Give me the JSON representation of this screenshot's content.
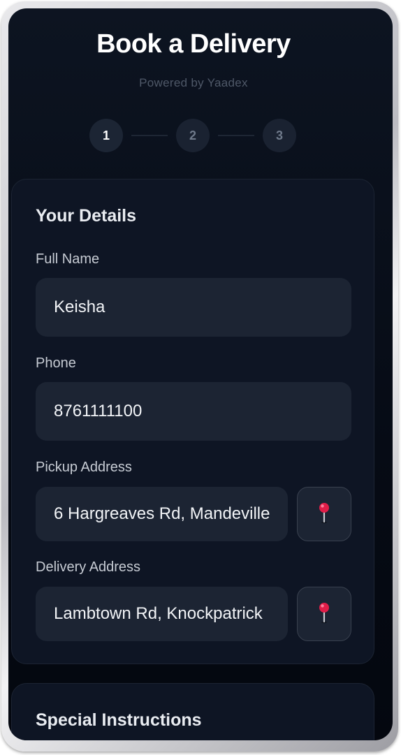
{
  "header": {
    "title": "Book a Delivery",
    "subtitle": "Powered by Yaadex"
  },
  "stepper": {
    "steps": [
      {
        "label": "1",
        "active": true
      },
      {
        "label": "2",
        "active": false
      },
      {
        "label": "3",
        "active": false
      }
    ]
  },
  "details": {
    "title": "Your Details",
    "full_name": {
      "label": "Full Name",
      "value": "Keisha"
    },
    "phone": {
      "label": "Phone",
      "value": "8761111100"
    },
    "pickup": {
      "label": "Pickup Address",
      "value": "6 Hargreaves Rd, Mandeville",
      "icon": "map-pin-icon"
    },
    "delivery": {
      "label": "Delivery Address",
      "value": "Lambtown Rd, Knockpatrick",
      "icon": "map-pin-icon"
    }
  },
  "special": {
    "title": "Special Instructions"
  },
  "colors": {
    "background": "#060b15",
    "card": "#0e1524",
    "field": "#1c2433",
    "pin": "#e11d48"
  }
}
